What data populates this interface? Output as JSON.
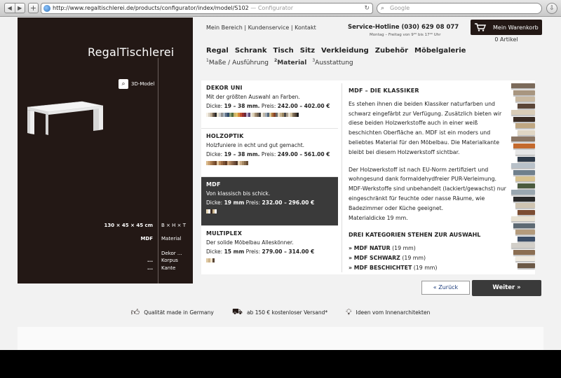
{
  "browser": {
    "url": "http://www.regaltischlerei.de/products/configurator/index/model/S102",
    "tab_title": "Configurator",
    "separator": "—",
    "search_placeholder": "Google"
  },
  "brand": {
    "logo": "RegalTischlerei"
  },
  "viewer": {
    "model3d_label": "3D-Model",
    "dimensions": [
      {
        "left": "130 × 45 × 45 cm",
        "right": "B × H × T"
      },
      {
        "left": "MDF",
        "right": "Material"
      },
      {
        "left": "",
        "right": "Dekor ..."
      },
      {
        "left": "...",
        "right": "Korpus"
      },
      {
        "left": "...",
        "right": "Kante"
      }
    ]
  },
  "header": {
    "links": [
      "Mein Bereich",
      "Kundenservice",
      "Kontakt"
    ],
    "link_sep": "|",
    "hotline": "Service-Hotline (030) 629 08 077",
    "hours": "Montag – Freitag von 9⁰⁰ bis 17⁰⁰ Uhr",
    "cart_label": "Mein Warenkorb",
    "cart_count": "0 Artikel"
  },
  "nav": [
    "Regal",
    "Schrank",
    "Tisch",
    "Sitz",
    "Verkleidung",
    "Zubehör",
    "Möbelgalerie"
  ],
  "steps": [
    {
      "num": "1",
      "label": "Maße / Ausführung"
    },
    {
      "num": "2",
      "label": "Material"
    },
    {
      "num": "3",
      "label": "Ausstattung"
    }
  ],
  "categories": [
    {
      "title": "DEKOR UNI",
      "desc": "Mit der größten Auswahl an Farben.",
      "dicke_label": "Dicke:",
      "dicke": "19 – 38 mm.",
      "preis_label": "Preis:",
      "preis": "242.00 – 402.00 €"
    },
    {
      "title": "HOLZOPTIK",
      "desc": "Holzfuniere in echt und gut gemacht.",
      "dicke_label": "Dicke:",
      "dicke": "19 – 38 mm.",
      "preis_label": "Preis:",
      "preis": "249.00 – 561.00 €"
    },
    {
      "title": "MDF",
      "desc": "Von klassisch bis schick.",
      "dicke_label": "Dicke:",
      "dicke": "19 mm",
      "preis_label": "Preis:",
      "preis": "232.00 – 296.00 €"
    },
    {
      "title": "MULTIPLEX",
      "desc": "Der solide Möbelbau Alleskönner.",
      "dicke_label": "Dicke:",
      "dicke": "15 mm",
      "preis_label": "Preis:",
      "preis": "279.00 – 314.00 €"
    }
  ],
  "description": {
    "title": "MDF – DIE KLASSIKER",
    "p1": "Es stehen ihnen die beiden Klassiker naturfarben und schwarz eingefärbt zur Verfügung. Zusätzlich bieten wir diese beiden Holzwerkstoffe auch in einer weiß beschichten Oberfläche an. MDF ist ein moders und beliebtes Material für den Möbelbau. Die Materialkante bleibt bei diesem Holzwerkstoff sichtbar.",
    "p2": "Der Holzwerkstoff ist nach EU-Norm zertifiziert und wohngesund dank formaldehydfreier PUR-Verleimung. MDF-Werkstoffe sind unbehandelt (lackiert/gewachst) nur eingeschränkt für feuchte oder nasse Räume, wie  Badezimmer oder Küche geeignet.",
    "p2b": "Materialdicke 19 mm.",
    "cat_heading": "DREI KATEGORIEN STEHEN ZUR AUSWAHL",
    "options": [
      {
        "name": "» MDF NATUR",
        "thick": "(19 mm)"
      },
      {
        "name": "» MDF SCHWARZ",
        "thick": "(19 mm)"
      },
      {
        "name": "» MDF BESCHICHTET",
        "thick": "(19 mm)"
      }
    ]
  },
  "buttons": {
    "back": "« Zurück",
    "next": "Weiter »"
  },
  "footer": [
    {
      "icon": "thumbs-up-icon",
      "text": "Qualität made in Germany"
    },
    {
      "icon": "truck-icon",
      "text": "ab 150 € kostenloser Versand*"
    },
    {
      "icon": "lightbulb-icon",
      "text": "Ideen vom Innenarchitekten"
    }
  ]
}
